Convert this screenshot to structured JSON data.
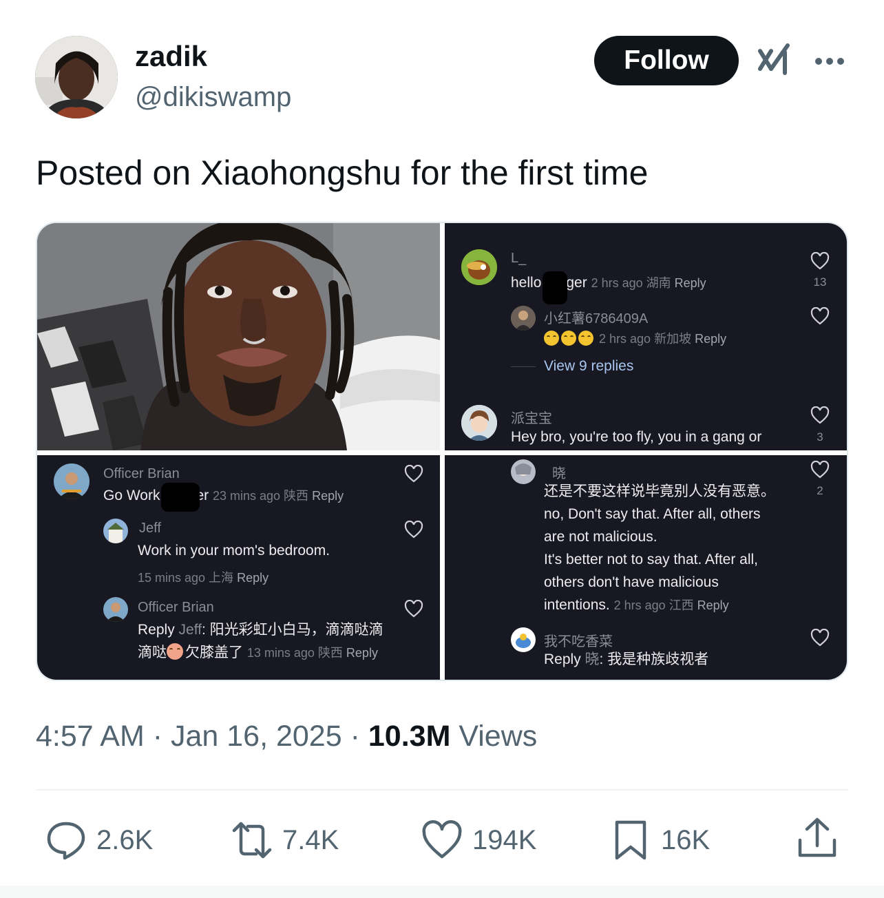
{
  "author": {
    "name": "zadik",
    "handle": "@dikiswamp",
    "follow_label": "Follow"
  },
  "post": {
    "text": "Posted on Xiaohongshu for the first time"
  },
  "media": {
    "panel_tr": {
      "c1_user": "L_",
      "c1_text_a": "hello",
      "c1_text_b": "ger",
      "c1_meta": "2 hrs ago 湖南",
      "c1_reply": "Reply",
      "c1_likes": "13",
      "c2_user": "小红薯6786409A",
      "c2_meta": "2 hrs ago 新加坡",
      "c2_reply": "Reply",
      "view_replies": "View 9 replies",
      "c3_user": "派宝宝",
      "c3_text": "Hey bro, you're too fly, you in a gang or",
      "c3_likes": "3"
    },
    "panel_bl": {
      "c1_user": "Officer Brian",
      "c1_text_a": "Go Work",
      "c1_text_b": "er",
      "c1_meta": "23 mins ago 陕西",
      "c1_reply": "Reply",
      "c2_user": "Jeff",
      "c2_text": "Work in your mom's bedroom.",
      "c2_meta": "15 mins ago 上海",
      "c2_reply": "Reply",
      "c3_user": "Officer Brian",
      "c3_prefix": "Reply",
      "c3_target": "Jeff",
      "c3_text": ": 阳光彩虹小白马，滴滴哒滴",
      "c3_text2": "滴哒",
      "c3_text3": "欠膝盖了",
      "c3_meta": "13 mins ago 陕西",
      "c3_reply": "Reply"
    },
    "panel_br": {
      "c1_user": "晓",
      "c1_line1": "还是不要这样说毕竟别人没有恶意。",
      "c1_line2": "no,  Don't say that. After all, others",
      "c1_line3": "are not malicious.",
      "c1_line4": "It's better not to say that. After all,",
      "c1_line5": "others don't have malicious",
      "c1_line6": "intentions.",
      "c1_meta": "2 hrs ago 江西",
      "c1_reply": "Reply",
      "c1_likes": "2",
      "c2_user": "我不吃香菜",
      "c2_prefix": "Reply",
      "c2_target": "晓",
      "c2_text": ": 我是种族歧视者"
    }
  },
  "timestamp": {
    "time": "4:57 AM",
    "sep1": " · ",
    "date": "Jan 16, 2025",
    "sep2": " · ",
    "views_count": "10.3M",
    "views_label": " Views"
  },
  "actions": {
    "replies": "2.6K",
    "reposts": "7.4K",
    "likes": "194K",
    "bookmarks": "16K"
  },
  "colors": {
    "text": "#0f1419",
    "muted": "#536471",
    "panel_bg": "#181822",
    "follow_bg": "#0f1419"
  }
}
